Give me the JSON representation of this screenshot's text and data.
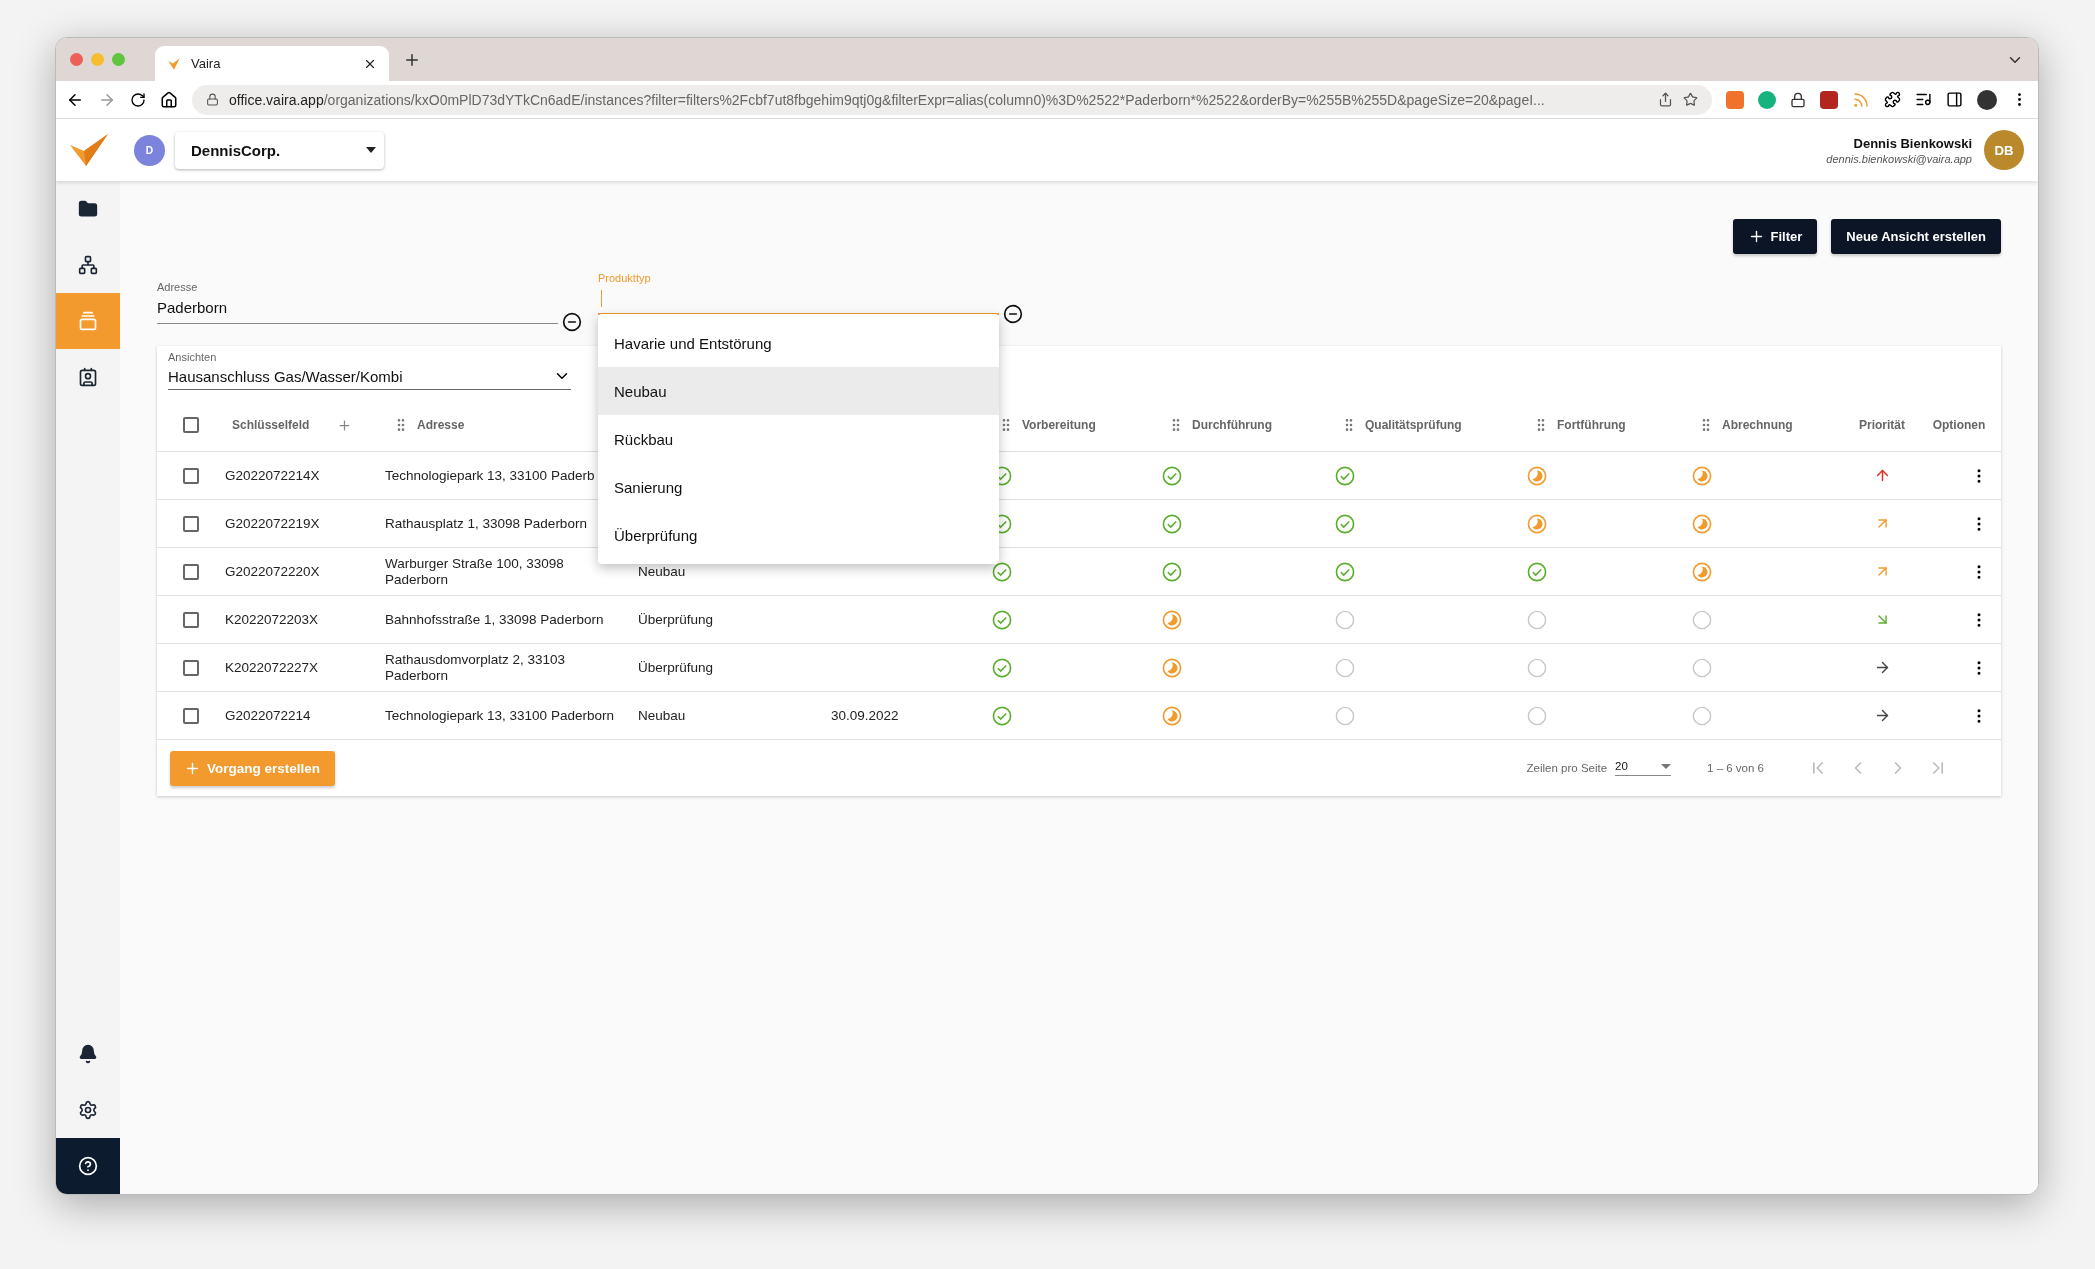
{
  "browser": {
    "tab_title": "Vaira",
    "url_host": "office.vaira.app",
    "url_path": "/organizations/kxO0mPlD73dYTkCn6adE/instances?filter=filters%2Fcbf7ut8fbgehim9qtj0g&filterExpr=alias(column0)%3D%2522*Paderborn*%2522&orderBy=%255B%255D&pageSize=20&pageI..."
  },
  "header": {
    "org_avatar": "D",
    "org_name": "DennisCorp.",
    "user_name": "Dennis Bienkowski",
    "user_email": "dennis.bienkowski@vaira.app",
    "user_avatar": "DB"
  },
  "sidebar": {
    "top": [
      {
        "kind": "folder",
        "selected": false
      },
      {
        "kind": "hierarchy",
        "selected": false
      },
      {
        "kind": "cards",
        "selected": true
      },
      {
        "kind": "contact",
        "selected": false
      }
    ],
    "bottom": [
      {
        "kind": "bell",
        "selected": false
      },
      {
        "kind": "settings",
        "selected": false
      },
      {
        "kind": "help",
        "selected": false
      }
    ]
  },
  "toolbar": {
    "buttons": [
      "Filter",
      "Neue Ansicht erstellen"
    ]
  },
  "filters": [
    {
      "label": "Adresse",
      "value": "Paderborn",
      "focused": false
    },
    {
      "label": "Produkttyp",
      "focused": true
    }
  ],
  "dropdown": {
    "options": [
      {
        "label": "Havarie und Entstörung",
        "selected": false
      },
      {
        "label": "Neubau",
        "selected": true
      },
      {
        "label": "Rückbau",
        "selected": false
      },
      {
        "label": "Sanierung",
        "selected": false
      },
      {
        "label": "Überprüfung",
        "selected": false
      }
    ]
  },
  "views": {
    "label": "Ansichten",
    "value": "Hausanschluss Gas/Wasser/Kombi"
  },
  "table": {
    "all_checked": false,
    "columns": [
      {
        "label": "Schlüsselfeld",
        "kind": "key"
      },
      {
        "label": "Adresse",
        "kind": "drag"
      },
      {
        "kind": "covered"
      },
      {
        "kind": "covered"
      },
      {
        "label": "Vorbereitung",
        "kind": "drag"
      },
      {
        "label": "Durchführung",
        "kind": "drag"
      },
      {
        "label": "Qualitätsprüfung",
        "kind": "drag"
      },
      {
        "label": "Fortführung",
        "kind": "drag"
      },
      {
        "label": "Abrechnung",
        "kind": "drag"
      },
      {
        "label": "Priorität",
        "kind": "plain"
      },
      {
        "label": "Optionen",
        "kind": "plain"
      }
    ],
    "rows": [
      {
        "checked": false,
        "key": "G2022072214X",
        "address": "Technologiepark 13, 33100 Paderb",
        "stages": [
          {
            "kind": "done"
          },
          {
            "kind": "done"
          },
          {
            "kind": "done"
          },
          {
            "kind": "progress"
          },
          {
            "kind": "progress"
          }
        ],
        "priority": {
          "kind": "high"
        }
      },
      {
        "checked": false,
        "key": "G2022072219X",
        "address": "Rathausplatz 1, 33098 Paderborn",
        "stages": [
          {
            "kind": "done"
          },
          {
            "kind": "done"
          },
          {
            "kind": "done"
          },
          {
            "kind": "progress"
          },
          {
            "kind": "progress"
          }
        ],
        "priority": {
          "kind": "medium"
        }
      },
      {
        "checked": false,
        "key": "G2022072220X",
        "address": "Warburger Straße 100, 33098 Paderborn",
        "type": "Neubau",
        "stages": [
          {
            "kind": "done"
          },
          {
            "kind": "done"
          },
          {
            "kind": "done"
          },
          {
            "kind": "done"
          },
          {
            "kind": "progress"
          }
        ],
        "priority": {
          "kind": "medium"
        }
      },
      {
        "checked": false,
        "key": "K2022072203X",
        "address": "Bahnhofsstraße 1, 33098 Paderborn",
        "type": "Überprüfung",
        "stages": [
          {
            "kind": "done"
          },
          {
            "kind": "progress"
          },
          {
            "kind": "open"
          },
          {
            "kind": "open"
          },
          {
            "kind": "open"
          }
        ],
        "priority": {
          "kind": "low"
        }
      },
      {
        "checked": false,
        "key": "K2022072227X",
        "address": "Rathausdomvorplatz 2, 33103 Paderborn",
        "type": "Überprüfung",
        "stages": [
          {
            "kind": "done"
          },
          {
            "kind": "progress"
          },
          {
            "kind": "open"
          },
          {
            "kind": "open"
          },
          {
            "kind": "open"
          }
        ],
        "priority": {
          "kind": "normal"
        }
      },
      {
        "checked": false,
        "key": "G2022072214",
        "address": "Technologiepark 13, 33100 Paderborn",
        "type": "Neubau",
        "date": "30.09.2022",
        "stages": [
          {
            "kind": "done"
          },
          {
            "kind": "progress"
          },
          {
            "kind": "open"
          },
          {
            "kind": "open"
          },
          {
            "kind": "open"
          }
        ],
        "priority": {
          "kind": "normal"
        }
      }
    ]
  },
  "footer": {
    "create_button": "Vorgang erstellen",
    "rows_label": "Zeilen pro Seite",
    "page_size": "20",
    "range": "1 – 6 von 6",
    "nav": [
      {
        "kind": "first",
        "disabled": true
      },
      {
        "kind": "prev",
        "disabled": true
      },
      {
        "kind": "next",
        "disabled": true
      },
      {
        "kind": "last",
        "disabled": true
      }
    ]
  }
}
